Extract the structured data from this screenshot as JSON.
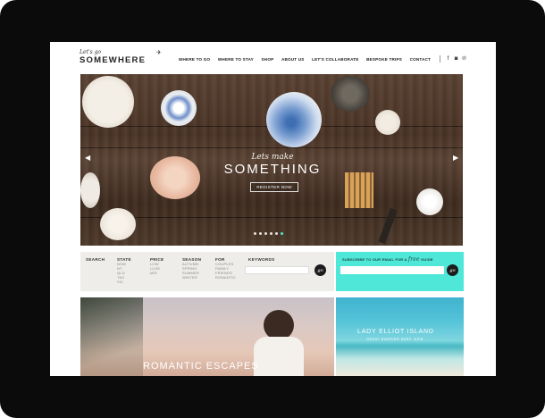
{
  "logo": {
    "script": "Let's go",
    "main": "SOMEWHERE"
  },
  "nav": [
    "WHERE TO GO",
    "WHERE TO STAY",
    "SHOP",
    "ABOUT US",
    "LET'S COLLABORATE",
    "BESPOKE TRIPS",
    "CONTACT"
  ],
  "social": [
    "facebook-icon",
    "instagram-icon",
    "pinterest-icon"
  ],
  "hero": {
    "script": "Lets make",
    "title": "SOMETHING",
    "button": "REGISTER NOW",
    "slides": 6,
    "active_slide": 6
  },
  "search": {
    "label": "SEARCH",
    "columns": [
      {
        "head": "STATE",
        "items": [
          "NSW",
          "NT",
          "QLD",
          "TAS",
          "VIC"
        ]
      },
      {
        "head": "PRICE",
        "items": [
          "LOW",
          "LUXE",
          "MID"
        ]
      },
      {
        "head": "SEASON",
        "items": [
          "AUTUMN",
          "SPRING",
          "SUMMER",
          "WINTER"
        ]
      },
      {
        "head": "FOR",
        "items": [
          "COUPLES",
          "FAMILY",
          "FRIENDS",
          "ROMANTIC"
        ]
      }
    ],
    "keywords_label": "KEYWORDS",
    "go": "go"
  },
  "subscribe": {
    "label": "SUBSCRIBE TO OUR EMAIL FOR A",
    "script": "free",
    "label_end": "GUIDE",
    "go": "go"
  },
  "tiles": {
    "left": {
      "title": "ROMANTIC ESCAPES"
    },
    "right": {
      "title": "LADY ELLIOT ISLAND",
      "subtitle": "GREAT BARRIER REEF, NSW"
    }
  },
  "colors": {
    "accent": "#4fe8d8",
    "device": "#0b0b0b"
  }
}
